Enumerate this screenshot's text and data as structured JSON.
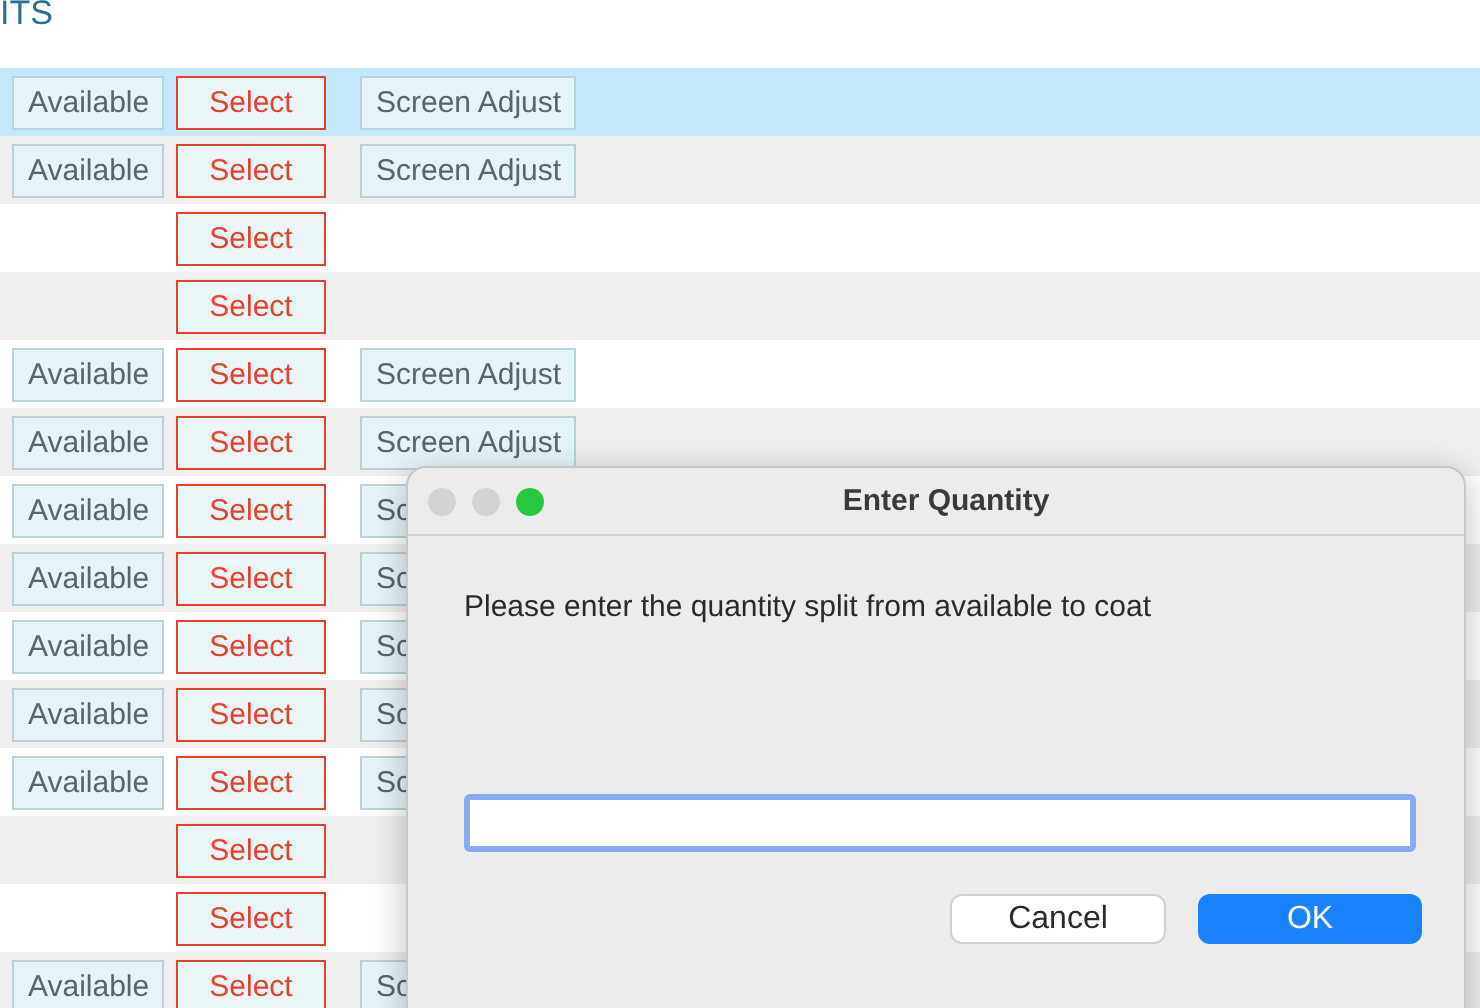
{
  "header": {
    "title": "ITS"
  },
  "rows": [
    {
      "selected": true,
      "available": "Available",
      "select": "Select",
      "adjust": "Screen Adjust"
    },
    {
      "selected": false,
      "available": "Available",
      "select": "Select",
      "adjust": "Screen Adjust"
    },
    {
      "selected": false,
      "select": "Select"
    },
    {
      "selected": false,
      "select": "Select"
    },
    {
      "selected": false,
      "available": "Available",
      "select": "Select",
      "adjust": "Screen Adjust"
    },
    {
      "selected": false,
      "available": "Available",
      "select": "Select",
      "adjust": "Screen Adjust"
    },
    {
      "selected": false,
      "available": "Available",
      "select": "Select",
      "adjust": "Sc"
    },
    {
      "selected": false,
      "available": "Available",
      "select": "Select",
      "adjust": "Sc"
    },
    {
      "selected": false,
      "available": "Available",
      "select": "Select",
      "adjust": "Sc"
    },
    {
      "selected": false,
      "available": "Available",
      "select": "Select",
      "adjust": "Sc"
    },
    {
      "selected": false,
      "available": "Available",
      "select": "Select",
      "adjust": "Sc"
    },
    {
      "selected": false,
      "select": "Select"
    },
    {
      "selected": false,
      "select": "Select"
    },
    {
      "selected": false,
      "available": "Available",
      "select": "Select",
      "adjust": "Sc"
    }
  ],
  "dialog": {
    "title": "Enter Quantity",
    "message": "Please enter the quantity split from available to coat",
    "buttons": [
      {
        "label": "Cancel",
        "kind": "secondary"
      },
      {
        "label": "OK",
        "kind": "primary"
      }
    ]
  }
}
